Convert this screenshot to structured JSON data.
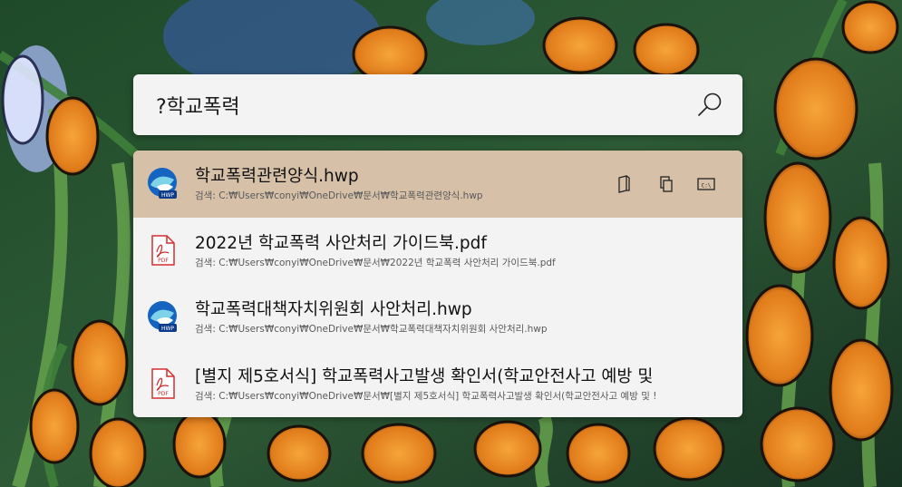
{
  "search": {
    "query": "?학교폭력",
    "icon": "search-icon"
  },
  "results": [
    {
      "title": "학교폭력관련양식.hwp",
      "path": "검색: C:₩Users₩conyi₩OneDrive₩문서₩학교폭력관련양식.hwp",
      "icon": "hwp-file-icon",
      "selected": true
    },
    {
      "title": "2022년 학교폭력 사안처리 가이드북.pdf",
      "path": "검색: C:₩Users₩conyi₩OneDrive₩문서₩2022년 학교폭력 사안처리 가이드북.pdf",
      "icon": "pdf-file-icon",
      "selected": false
    },
    {
      "title": "학교폭력대책자치위원회 사안처리.hwp",
      "path": "검색: C:₩Users₩conyi₩OneDrive₩문서₩학교폭력대책자치위원회 사안처리.hwp",
      "icon": "hwp-file-icon",
      "selected": false
    },
    {
      "title": "[별지 제5호서식] 학교폭력사고발생 확인서(학교안전사고 예방 및",
      "path": "검색: C:₩Users₩conyi₩OneDrive₩문서₩[별지 제5호서식] 학교폭력사고발생 확인서(학교안전사고 예방 및 !",
      "icon": "pdf-file-icon",
      "selected": false
    }
  ],
  "row_actions": [
    {
      "icon": "open-folder-icon"
    },
    {
      "icon": "copy-path-icon"
    },
    {
      "icon": "open-console-icon"
    }
  ],
  "colors": {
    "selected_row": "#d6c0a8",
    "panel": "#f3f3f3",
    "pdf_red": "#d32f2f",
    "hwp_blue": "#1565c0"
  }
}
